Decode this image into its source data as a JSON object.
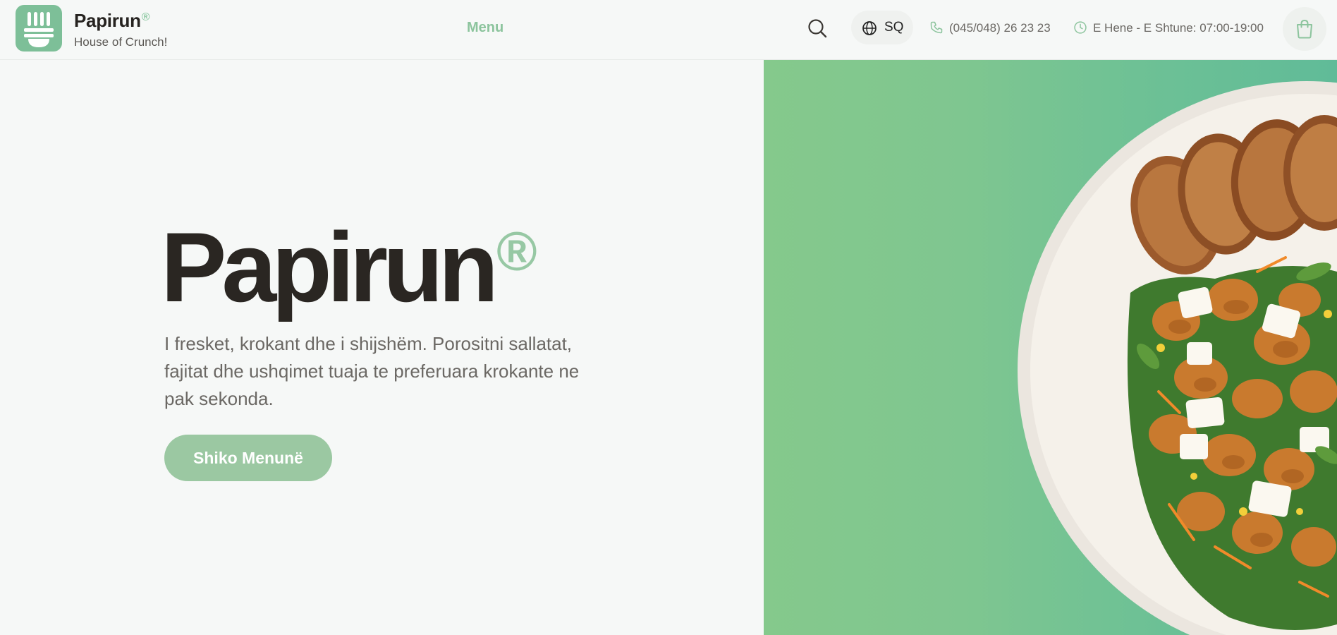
{
  "brand": {
    "name": "Papirun",
    "registered_mark": "®",
    "tagline": "House of Crunch!"
  },
  "nav": {
    "menu_label": "Menu"
  },
  "header": {
    "language": "SQ",
    "phone": "(045/048) 26 23 23",
    "hours": "E Hene - E Shtune: 07:00-19:00"
  },
  "hero": {
    "title": "Papirun",
    "registered_mark": "®",
    "description": "I fresket, krokant dhe i shijshëm. Porositni sallatat, fajitat dhe ushqimet tuaja te preferuara krokante ne pak sekonda.",
    "cta_label": "Shiko Menunë"
  },
  "icons": {
    "logo": "fork-logo-icon",
    "search": "search-icon",
    "language": "globe-icon",
    "phone": "phone-icon",
    "hours": "clock-icon",
    "cart": "shopping-bag-icon"
  },
  "colors": {
    "accent": "#8cc49d",
    "logo_bg": "#7dbf98",
    "cta_bg": "#9bc8a2",
    "panel_start": "#85c98c",
    "panel_end": "#60bb98",
    "text_dark": "#2a2622"
  }
}
